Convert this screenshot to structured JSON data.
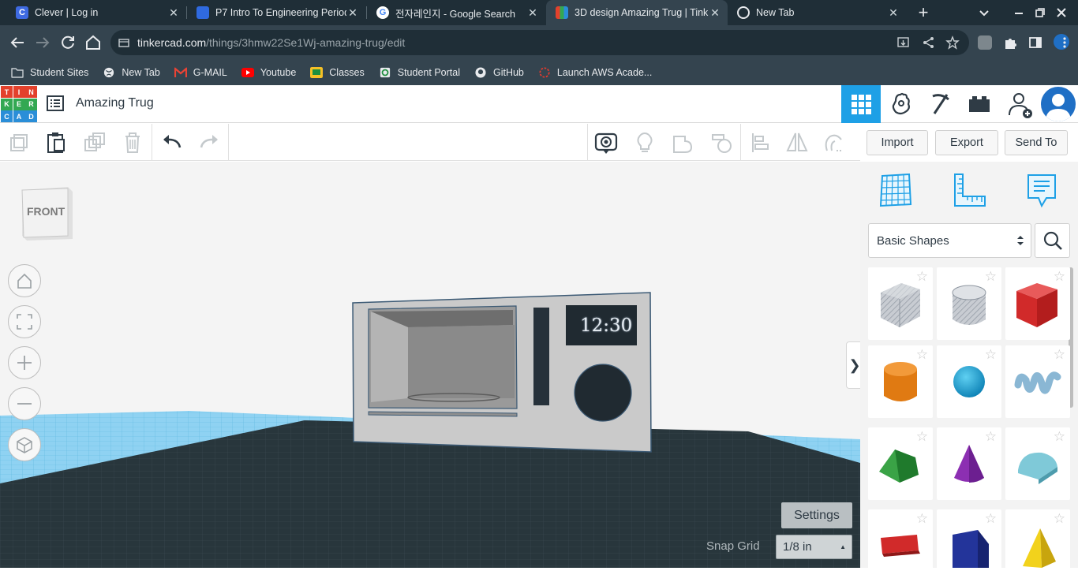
{
  "browser": {
    "tabs": [
      {
        "title": "Clever | Log in",
        "favicon_color": "#3e6ae1",
        "favicon_letter": "C"
      },
      {
        "title": "P7 Intro To Engineering Period",
        "favicon_color": "#2f6ae0",
        "favicon_letter": ""
      },
      {
        "title": "전자레인지 - Google Search",
        "favicon_color": "#ffffff",
        "favicon_letter": "G"
      },
      {
        "title": "3D design Amazing Trug | Tink",
        "favicon_color": "#e64a3b",
        "favicon_letter": ""
      },
      {
        "title": "New Tab",
        "favicon_color": "#e8eaed",
        "favicon_letter": ""
      }
    ],
    "close_glyph": "✕",
    "new_tab_glyph": "+",
    "url_host": "tinkercad.com",
    "url_path": "/things/3hmw22Se1Wj-amazing-trug/edit",
    "bookmarks": [
      {
        "label": "Student Sites",
        "color": "#9aa0a6"
      },
      {
        "label": "New Tab",
        "color": "#e8eaed"
      },
      {
        "label": "G-MAIL",
        "color": "#ea4335"
      },
      {
        "label": "Youtube",
        "color": "#ff0000"
      },
      {
        "label": "Classes",
        "color": "#f6c026"
      },
      {
        "label": "Student Portal",
        "color": "#e8eaed"
      },
      {
        "label": "GitHub",
        "color": "#e8eaed"
      },
      {
        "label": "Launch AWS Acade...",
        "color": "#e33b2e"
      }
    ]
  },
  "tinkercad": {
    "logo_letters": [
      "T",
      "I",
      "N",
      "K",
      "E",
      "R",
      "C",
      "A",
      "D"
    ],
    "logo_colors": [
      "#e3412c",
      "#e3412c",
      "#e3412c",
      "#33a852",
      "#33a852",
      "#33a852",
      "#2a8ed8",
      "#2a8ed8",
      "#2a8ed8"
    ],
    "design_title": "Amazing Trug",
    "actions": {
      "import": "Import",
      "export": "Export",
      "send_to": "Send To"
    },
    "shapes_category": "Basic Shapes",
    "view_cube_label": "FRONT",
    "settings_label": "Settings",
    "snap_grid_label": "Snap Grid",
    "snap_grid_value": "1/8 in",
    "collapse_glyph": "❯",
    "clock_text": "12:30",
    "accent": "#1ea0e6"
  }
}
